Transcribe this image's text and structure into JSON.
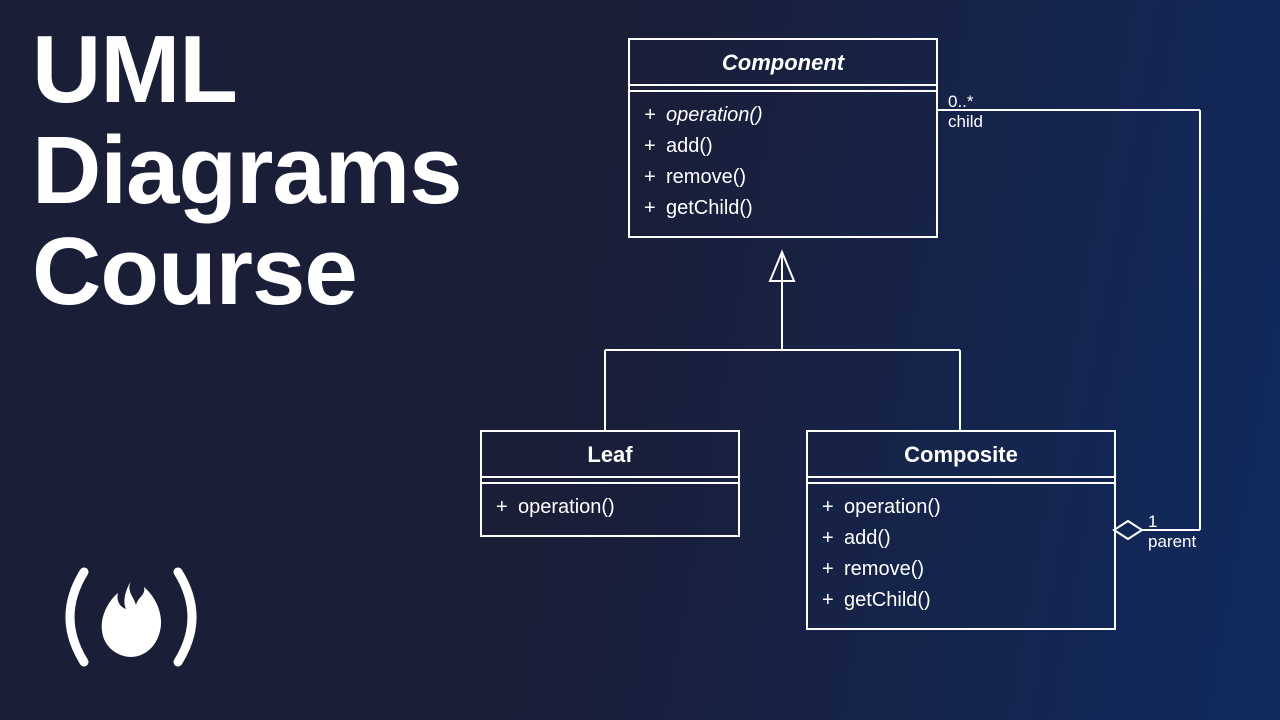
{
  "title": {
    "line1": "UML",
    "line2": "Diagrams",
    "line3": "Course"
  },
  "diagram": {
    "component": {
      "name": "Component",
      "methods": [
        {
          "text": "operation()",
          "italic": true
        },
        {
          "text": "add()",
          "italic": false
        },
        {
          "text": "remove()",
          "italic": false
        },
        {
          "text": "getChild()",
          "italic": false
        }
      ]
    },
    "leaf": {
      "name": "Leaf",
      "methods": [
        {
          "text": "operation()",
          "italic": false
        }
      ]
    },
    "composite": {
      "name": "Composite",
      "methods": [
        {
          "text": "operation()",
          "italic": false
        },
        {
          "text": "add()",
          "italic": false
        },
        {
          "text": "remove()",
          "italic": false
        },
        {
          "text": "getChild()",
          "italic": false
        }
      ]
    },
    "associations": {
      "child": {
        "mult": "0..*",
        "role": "child"
      },
      "parent": {
        "mult": "1",
        "role": "parent"
      }
    }
  }
}
